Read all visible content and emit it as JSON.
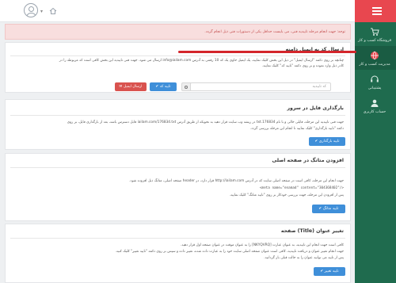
{
  "colors": {
    "sidebar": "#1f6b4e",
    "sidebar_head": "#e8474f",
    "primary": "#3f8fd9",
    "danger": "#d9534f",
    "alert_bg": "#f8dede",
    "alert_text": "#c34b4b"
  },
  "sidebar": {
    "items": [
      {
        "icon": "cart-icon",
        "label": "فروشگاه کسب و کار"
      },
      {
        "icon": "globe-icon",
        "label": "مدیریت کسب و کار"
      },
      {
        "icon": "headset-icon",
        "label": "پشتیبانی"
      },
      {
        "icon": "user-icon",
        "label": "حساب کاربری"
      }
    ]
  },
  "alert": {
    "text": "توجه: جهت انجام مرحله تاییدیه فنی، می بایست حداقل یکی از دستورات فنی ذیل انجام گردد."
  },
  "email_section": {
    "title": "ارسال کد به ایمیل دامنه",
    "desc_line1": "چنانچه بر روی دکمه \"ارسال ایمیل\" در ذیل این بخش کلیک نمایید، یک ایمیل حاوی یک کد 10 رقمی به آدرس info@iailam.com ارسال می شود. جهت فنی تاییدیه این بخش کافی است کد مربوطه را در",
    "desc_line2": "کادر ذیل وارد نموده و بر روی دکمه \"تایید کد\" کلیک نمایید.",
    "input_placeholder": "کد تاییدیه",
    "confirm_label": "✔ تایید کد",
    "send_label": "✉ ارسال ایمیل"
  },
  "upload_section": {
    "title": "بارگذاری فایل در سرور",
    "line1": "جهت فنی تاییدیه این مرحله، فایلی خالی و با نام 176834.txt در ریشه وب سایت قرار دهید به نحویکه از طریق آدرس iailam.com/176834.txt قابل دسترس باشد، بعد از بارگذاری فایل، بر روی",
    "line2": "دکمه \"تایید بارگذاری\" کلیک نمایید تا انجام این مرحله بررسی گردد.",
    "button": "✔ تایید بارگذاری"
  },
  "meta_section": {
    "title": "افزودن متاتگ در صفحه اصلی",
    "line1": "جهت انجام این مرحله، کافی است در صفحه اصلی سایت که در آدرس http://iailam.com قرار دارد، در header صفحه اصلی، متاتگ ذیل افزوده شود.",
    "code": "<meta name=\"enamad\" content=\"304368402\"/>",
    "line3": "پس از افزودن این مرحله، جهت بررسی خودکار بر روی \"تایید متاتگ\" کلیک نمایید.",
    "button": "✔ تایید متاتگ"
  },
  "title_section": {
    "title": "تغییر عنوان (Title) صفحه",
    "line1": "کافی است جهت انجام این تاییدیه، به عنوان عبارت [NKYQVRQ] را به عنوان موقت در عنوان صفحه اول قرار دهید.",
    "line2": "جهت انجام تغییر عنوان و دریافت تاییدیه، کافی است عنوان صفحه اصلی سایت خود را به عبارت داده شده، تغییر داده و سپس بر روی دکمه \"تایید تغییر\" کلیک کنید.",
    "line3": "پس از تایید می توانید عنوان را به حالت قبلی باز گردانید.",
    "button": "✔ تایید تغییر"
  }
}
